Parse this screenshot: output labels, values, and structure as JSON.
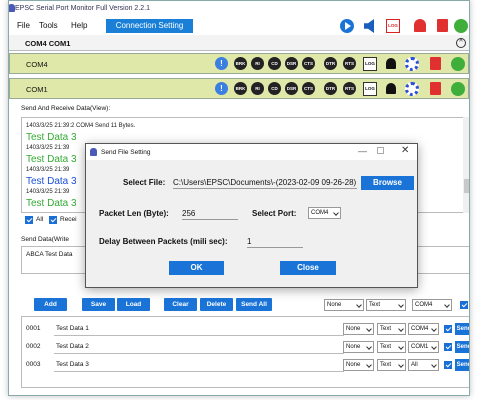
{
  "window": {
    "title": "EPSC Serial Port Monitor Full Version 2.2.1"
  },
  "menu": {
    "file": "File",
    "tools": "Tools",
    "help": "Help",
    "connection_setting": "Connection Setting"
  },
  "header": {
    "ports": "COM4 COM1"
  },
  "com_rows": [
    {
      "name": "COM4"
    },
    {
      "name": "COM1"
    }
  ],
  "toolbar_labels": {
    "brk": "BRK",
    "ri": "RI",
    "cd": "CD",
    "dsr": "DSR",
    "cts": "CTS",
    "dtr": "DTR",
    "rts": "RTS",
    "log": "LOG",
    "info": "!"
  },
  "log_section": {
    "label": "Send And Receive Data(View):",
    "lines": [
      {
        "kind": "meta",
        "text": "1403/3/25 21:39:2 COM4 Send 11 Bytes."
      },
      {
        "kind": "green",
        "text": "Test Data 3"
      },
      {
        "kind": "meta",
        "text": "1403/3/25 21:39"
      },
      {
        "kind": "green",
        "text": "Test Data 3"
      },
      {
        "kind": "meta",
        "text": "1403/3/25 21:39"
      },
      {
        "kind": "blue",
        "text": "Test Data 3"
      },
      {
        "kind": "meta",
        "text": "1403/3/25 21:39"
      },
      {
        "kind": "green",
        "text": "Test Data 3"
      }
    ],
    "all_label": "All",
    "rece_label": "Recei"
  },
  "send_section": {
    "label": "Send Data(Write",
    "text": "ABCA Test Data"
  },
  "actions": {
    "add": "Add",
    "save": "Save",
    "load": "Load",
    "clear": "Clear",
    "delete": "Delete",
    "send_all": "Send All"
  },
  "action_selects": {
    "none": "None",
    "text": "Text",
    "port": "COM4"
  },
  "list_rows": [
    {
      "num": "0001",
      "data": "Test Data 1",
      "mode": "None",
      "fmt": "Text",
      "port": "COM4",
      "send": "Send"
    },
    {
      "num": "0002",
      "data": "Test Data 2",
      "mode": "None",
      "fmt": "Text",
      "port": "COM1",
      "send": "Send"
    },
    {
      "num": "0003",
      "data": "Test Data 3",
      "mode": "None",
      "fmt": "Text",
      "port": "All",
      "send": "Send"
    }
  ],
  "dialog": {
    "title": "Send File Setting",
    "select_file_label": "Select File:",
    "file_path": "C:\\Users\\EPSC\\Documents\\-(2023-02-09 09-26-28).",
    "browse": "Browse",
    "packet_len_label": "Packet Len (Byte):",
    "packet_len": "256",
    "select_port_label": "Select Port:",
    "port": "COM4",
    "delay_label": "Delay Between Packets (mili sec):",
    "delay": "1",
    "ok": "OK",
    "close": "Close"
  },
  "colors": {
    "accent": "#1a74d8",
    "com_row_bg": "#dfe8a8",
    "green_text": "#33aa33",
    "blue_text": "#1a4fd8",
    "delete_red": "#e03030"
  }
}
